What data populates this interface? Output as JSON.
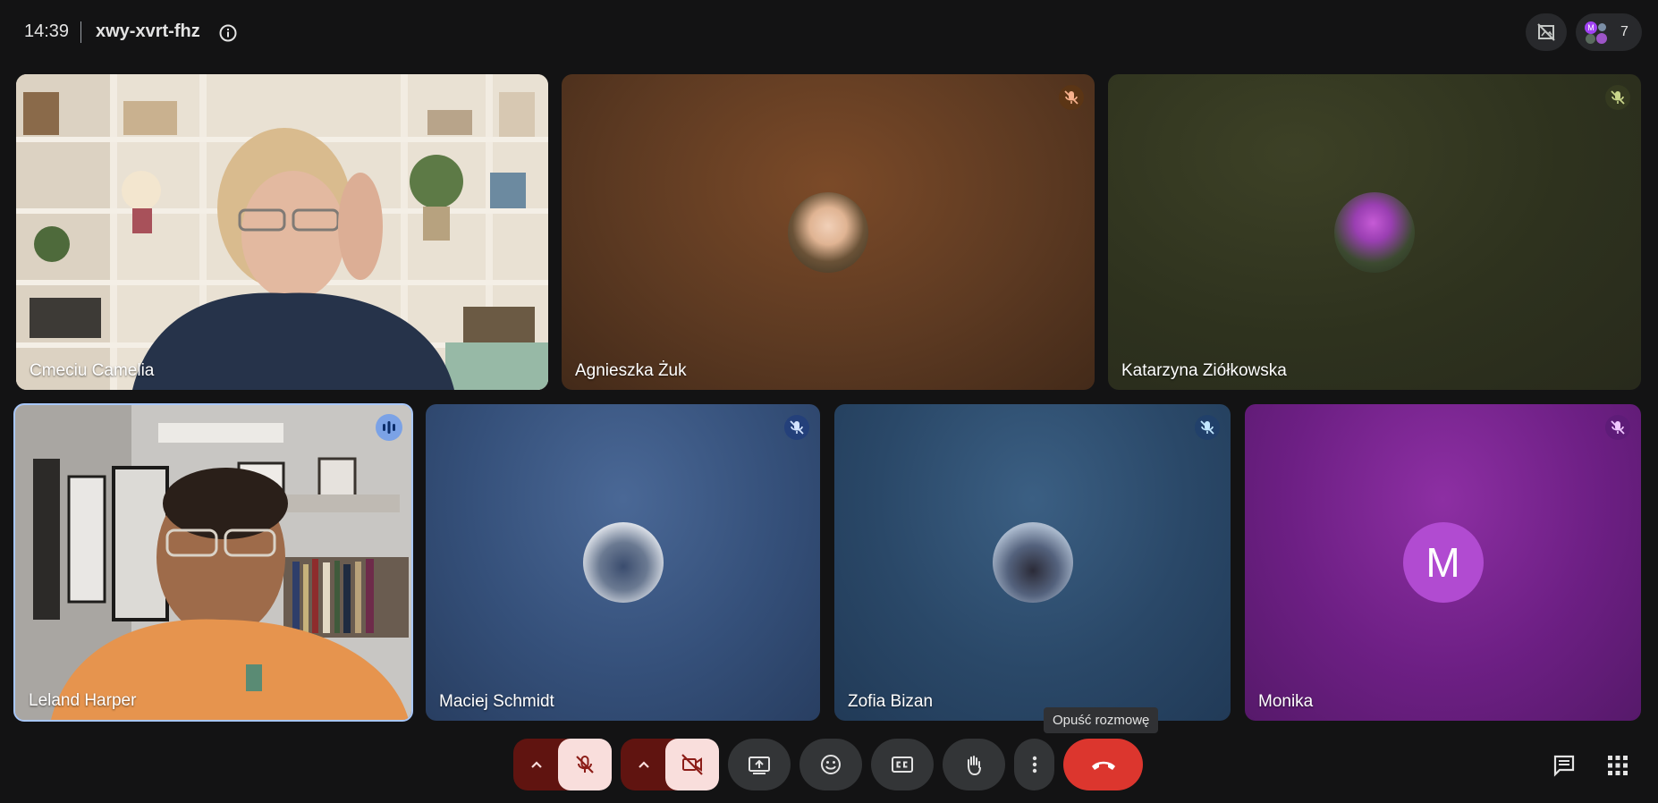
{
  "header": {
    "time": "14:39",
    "meeting_code": "xwy-xvrt-fhz",
    "info_icon": "info-icon",
    "participant_count": "7",
    "people_avatar_letter": "M"
  },
  "tiles": [
    {
      "name": "Cmeciu Camelia",
      "type": "video",
      "icon": "none"
    },
    {
      "name": "Agnieszka Żuk",
      "type": "avatar",
      "icon": "mic-off-icon"
    },
    {
      "name": "Katarzyna Ziółkowska",
      "type": "avatar",
      "icon": "mic-off-icon"
    },
    {
      "name": "Leland Harper",
      "type": "video",
      "icon": "speaking-indicator-icon"
    },
    {
      "name": "Maciej Schmidt",
      "type": "avatar",
      "icon": "mic-off-icon"
    },
    {
      "name": "Zofia Bizan",
      "type": "avatar",
      "icon": "mic-off-icon"
    },
    {
      "name": "Monika",
      "type": "letter-avatar",
      "icon": "mic-off-icon",
      "avatar_letter": "M",
      "avatar_color": "#b14bd1"
    }
  ],
  "tooltip": {
    "text": "Opuść rozmowę"
  },
  "controls": {
    "mic_group": {
      "arrow_icon": "chevron-up-icon",
      "icon": "mic-off-icon",
      "state": "off"
    },
    "camera_group": {
      "arrow_icon": "chevron-up-icon",
      "icon": "video-off-icon",
      "state": "off"
    },
    "buttons": [
      "present-screen-icon",
      "emoji-icon",
      "captions-icon",
      "raise-hand-icon",
      "more-options-icon"
    ],
    "end_call_icon": "hang-up-icon",
    "right": [
      "chat-icon",
      "activities-grid-icon"
    ]
  },
  "colors": {
    "background": "#131314",
    "end_call": "#dc362e",
    "muted_control_bg": "#601410",
    "muted_control_fg": "#f9dedc",
    "active_speaker_border": "#a8c7fa"
  }
}
